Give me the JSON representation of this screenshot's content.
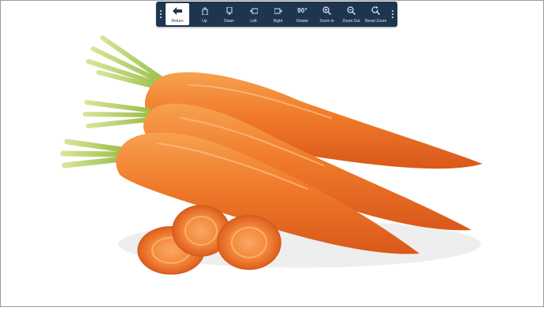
{
  "toolbar": {
    "buttons": [
      {
        "label": "Return",
        "icon": "arrow-left-icon"
      },
      {
        "label": "Up",
        "icon": "page-up-icon"
      },
      {
        "label": "Down",
        "icon": "page-down-icon"
      },
      {
        "label": "Left",
        "icon": "page-left-icon"
      },
      {
        "label": "Right",
        "icon": "page-right-icon"
      },
      {
        "label": "Rotate",
        "icon_text": "90°"
      },
      {
        "label": "Zoom In",
        "icon": "zoom-in-icon"
      },
      {
        "label": "Zoom Out",
        "icon": "zoom-out-icon"
      },
      {
        "label": "Reset Zoom",
        "icon": "reset-zoom-icon"
      }
    ],
    "colors": {
      "background": "#1e3550",
      "active": "#ffffff",
      "icon": "#dfe7ef"
    }
  },
  "image": {
    "subject": "carrots-photo",
    "colors": {
      "carrot": "#f07a2a",
      "greens": "#b9d36a"
    }
  }
}
